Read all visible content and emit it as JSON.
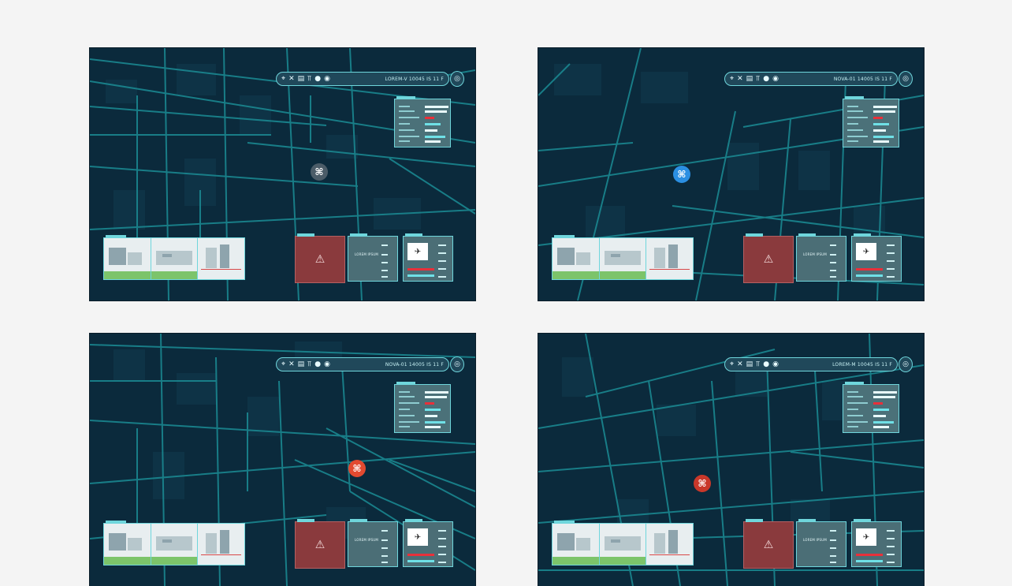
{
  "panels": [
    {
      "id": "top-left",
      "toolbar": {
        "readout": "LOREM-V 10045 IS 11 F"
      },
      "drone": {
        "color": "#4b5c68",
        "icon": "drone-icon"
      },
      "alert_icon": "⚠"
    },
    {
      "id": "top-right",
      "toolbar": {
        "readout": "NOVA-01 14005 IS 11 F"
      },
      "drone": {
        "color": "#2b8fe2",
        "icon": "drone-icon"
      },
      "alert_icon": "⚠"
    },
    {
      "id": "bottom-left",
      "toolbar": {
        "readout": "NOVA-01 14005 IS 11 F"
      },
      "drone": {
        "color": "#e24a30",
        "icon": "drone-icon"
      },
      "alert_icon": "⚠"
    },
    {
      "id": "bottom-right",
      "toolbar": {
        "readout": "LOREM-M 10045 IS 11 F"
      },
      "drone": {
        "color": "#c9382a",
        "icon": "drone-icon"
      },
      "alert_icon": "⚠"
    }
  ],
  "toolbar_icons": [
    "map-pin-icon",
    "close-icon",
    "layers-icon",
    "signal-icon",
    "globe-icon",
    "circle-icon"
  ],
  "stat_label": "LOREM IPSUM",
  "colors": {
    "background": "#f4f4f4",
    "map": "#0b2a3c",
    "road": "#1b8c94",
    "accent": "#6fd6dc",
    "alert": "#8a3a3d",
    "red": "#e8303a"
  }
}
